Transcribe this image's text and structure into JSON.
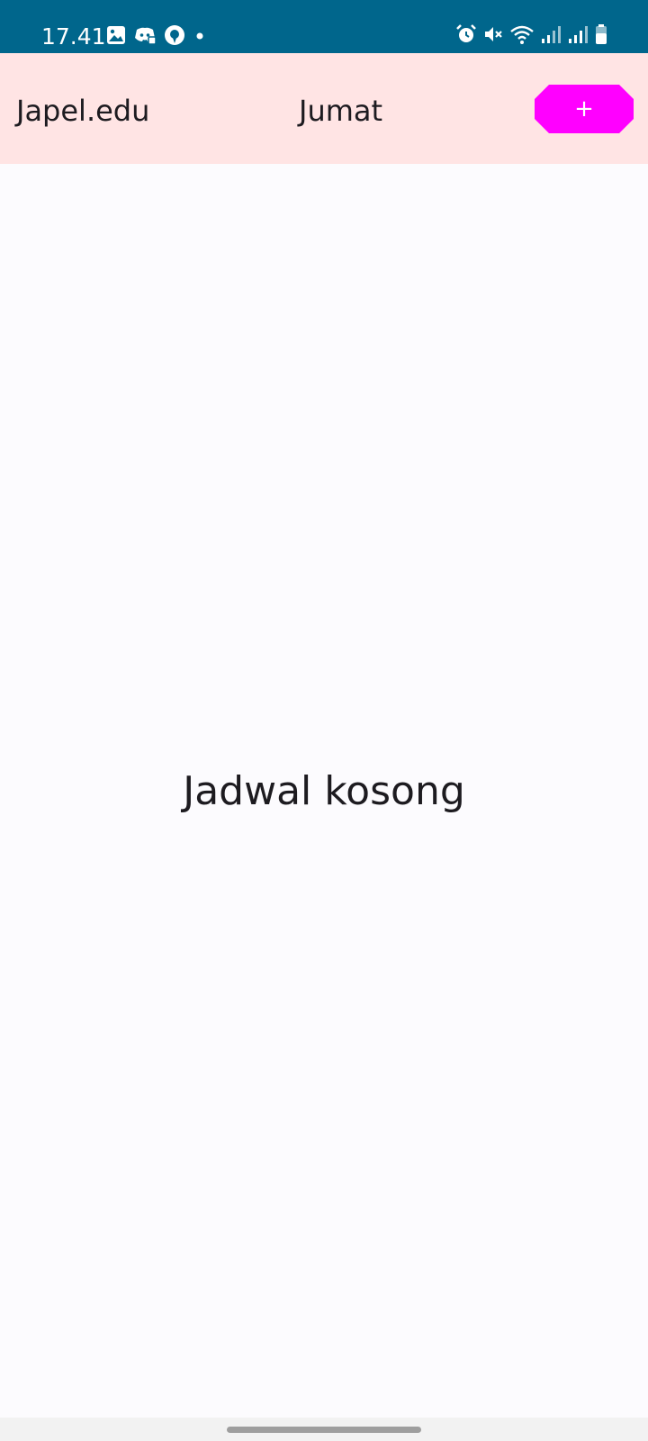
{
  "status_bar": {
    "time": "17.41",
    "left_icons": [
      "gallery-icon",
      "discord-icon",
      "circle-app-icon",
      "dot-icon"
    ],
    "right_icons": [
      "alarm-icon",
      "mute-icon",
      "wifi-icon",
      "signal-icon",
      "signal-icon",
      "battery-icon"
    ],
    "background_color": "#00668c"
  },
  "app_bar": {
    "app_name": "Japel.edu",
    "day": "Jumat",
    "add_button_label": "+",
    "background_color": "#ffe4e4",
    "button_color": "#ff00ff"
  },
  "main": {
    "empty_message": "Jadwal kosong"
  }
}
